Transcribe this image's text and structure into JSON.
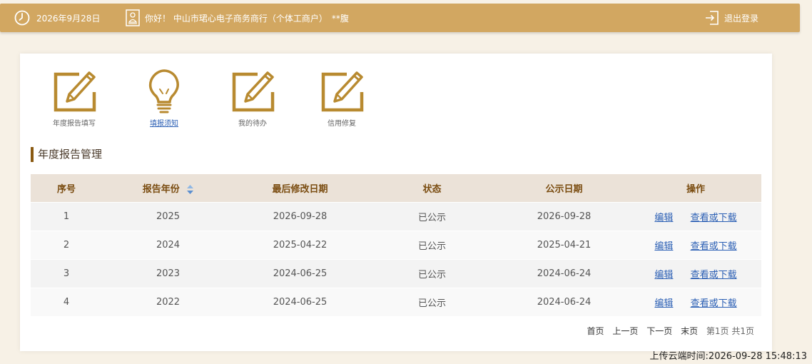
{
  "header": {
    "date": "2026年9月28日",
    "greeting": "你好！ 中山市珺心电子商务商行（个体工商户）　**腹",
    "logout_label": "退出登录"
  },
  "shortcuts": [
    {
      "label": "年度报告填写",
      "icon": "pen-edit-icon"
    },
    {
      "label": "填报须知",
      "icon": "lightbulb-icon"
    },
    {
      "label": "我的待办",
      "icon": "pen-edit-icon"
    },
    {
      "label": "信用修复",
      "icon": "pen-edit-icon"
    }
  ],
  "section_title": "年度报告管理",
  "table": {
    "headers": [
      "序号",
      "报告年份",
      "最后修改日期",
      "状态",
      "公示日期",
      "操作"
    ],
    "rows": [
      {
        "index": "1",
        "year": "2025",
        "modified": "2026-09-28",
        "status": "已公示",
        "published": "2026-09-28",
        "edit": "编辑",
        "view": "查看或下载"
      },
      {
        "index": "2",
        "year": "2024",
        "modified": "2025-04-22",
        "status": "已公示",
        "published": "2025-04-21",
        "edit": "编辑",
        "view": "查看或下载"
      },
      {
        "index": "3",
        "year": "2023",
        "modified": "2024-06-25",
        "status": "已公示",
        "published": "2024-06-24",
        "edit": "编辑",
        "view": "查看或下载"
      },
      {
        "index": "4",
        "year": "2022",
        "modified": "2024-06-25",
        "status": "已公示",
        "published": "2024-06-24",
        "edit": "编辑",
        "view": "查看或下载"
      }
    ]
  },
  "pager": {
    "first": "首页",
    "prev": "上一页",
    "next": "下一页",
    "last": "末页",
    "info": "第1页 共1页"
  },
  "upload_time": "上传云端时间:2026-09-28 15:48:13",
  "colors": {
    "header_bg": "#d2a761",
    "icon_gold": "#b88a30",
    "table_header_bg": "#ebe2d8",
    "link": "#2b5fb4"
  }
}
